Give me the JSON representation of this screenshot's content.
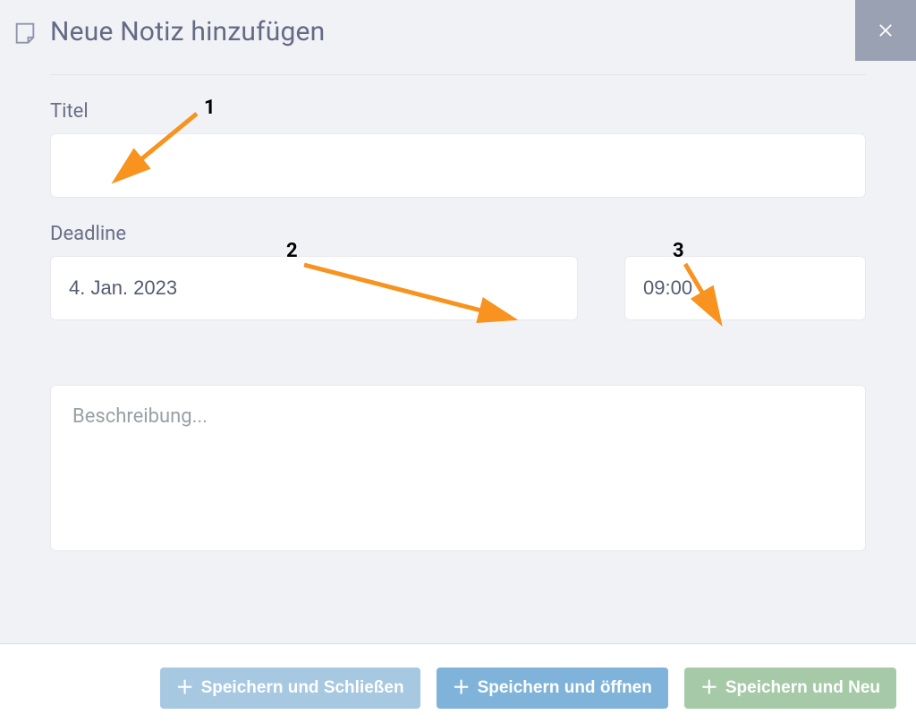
{
  "header": {
    "title": "Neue Notiz hinzufügen"
  },
  "form": {
    "title_label": "Titel",
    "title_value": "",
    "deadline_label": "Deadline",
    "deadline_date": "4. Jan. 2023",
    "deadline_time": "09:00",
    "description_placeholder": "Beschreibung..."
  },
  "buttons": {
    "save_close": "Speichern und Schließen",
    "save_open": "Speichern und öffnen",
    "save_new": "Speichern und Neu"
  },
  "annotations": {
    "n1": "1",
    "n2": "2",
    "n3": "3"
  }
}
